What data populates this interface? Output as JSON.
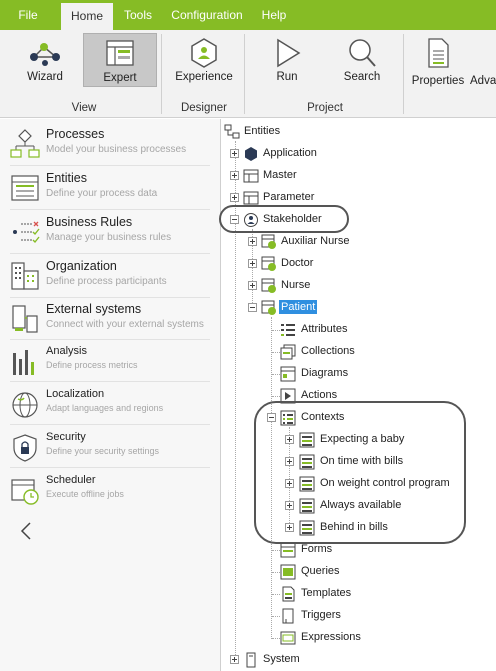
{
  "menu": [
    "File",
    "Home",
    "Tools",
    "Configuration",
    "Help"
  ],
  "ribbon": {
    "buttons": [
      "Wizard",
      "Expert",
      "Experience",
      "Run",
      "Search",
      "Properties",
      "Adva"
    ],
    "groups": [
      "View",
      "Designer",
      "Project"
    ]
  },
  "left_nav": [
    {
      "title": "Processes",
      "subtitle": "Model your business processes"
    },
    {
      "title": "Entities",
      "subtitle": "Define your process data"
    },
    {
      "title": "Business Rules",
      "subtitle": "Manage your business rules"
    },
    {
      "title": "Organization",
      "subtitle": "Define process participants"
    },
    {
      "title": "External systems",
      "subtitle": "Connect with your external systems"
    },
    {
      "title": "Analysis",
      "subtitle": "Define process metrics"
    },
    {
      "title": "Localization",
      "subtitle": "Adapt languages and regions"
    },
    {
      "title": "Security",
      "subtitle": "Define your security settings"
    },
    {
      "title": "Scheduler",
      "subtitle": "Execute offline jobs"
    }
  ],
  "tree": {
    "root": "Entities",
    "application": "Application",
    "master": "Master",
    "parameter": "Parameter",
    "stakeholder": "Stakeholder",
    "stakeholders": [
      "Auxiliar Nurse",
      "Doctor",
      "Nurse",
      "Patient"
    ],
    "patient_children": [
      "Attributes",
      "Collections",
      "Diagrams",
      "Actions",
      "Contexts"
    ],
    "contexts": [
      "Expecting a baby",
      "On time with bills",
      "On weight control program",
      "Always available",
      "Behind in bills"
    ],
    "patient_more": [
      "Forms",
      "Queries",
      "Templates",
      "Triggers",
      "Expressions"
    ],
    "system": "System"
  },
  "colors": {
    "accent": "#86bc25",
    "selection": "#2f8fe0"
  }
}
